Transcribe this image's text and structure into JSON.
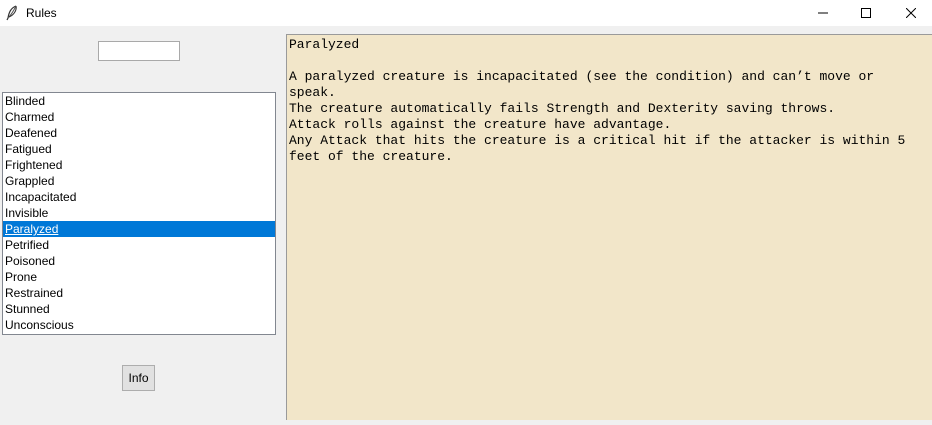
{
  "window": {
    "title": "Rules",
    "icon": "feather-icon",
    "controls": [
      "minimize-icon",
      "maximize-icon",
      "close-icon"
    ]
  },
  "search": {
    "value": ""
  },
  "conditions": {
    "items": [
      "Blinded",
      "Charmed",
      "Deafened",
      "Fatigued",
      "Frightened",
      "Grappled",
      "Incapacitated",
      "Invisible",
      "Paralyzed",
      "Petrified",
      "Poisoned",
      "Prone",
      "Restrained",
      "Stunned",
      "Unconscious"
    ],
    "selected": "Paralyzed"
  },
  "buttons": {
    "info_label": "Info"
  },
  "details": {
    "lines": [
      "Paralyzed",
      "",
      "A paralyzed creature is incapacitated (see the condition) and can’t move or",
      "speak.",
      "The creature automatically fails Strength and Dexterity saving throws.",
      "Attack rolls against the creature have advantage.",
      "Any Attack that hits the creature is a critical hit if the attacker is within 5",
      "feet of the creature."
    ]
  },
  "colors": {
    "selection": "#0078d7",
    "text_panel_bg": "#f2e6c9",
    "window_bg": "#f0f0f0"
  }
}
